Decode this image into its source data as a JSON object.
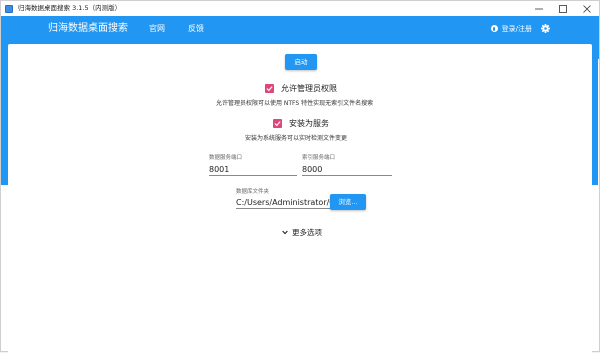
{
  "window": {
    "title": "归海数据桌面搜索 3.1.5（内测版）"
  },
  "header": {
    "brand": "归海数据桌面搜索",
    "nav": [
      {
        "label": "官网"
      },
      {
        "label": "反馈"
      }
    ],
    "login_label": "登录/注册"
  },
  "main": {
    "start_label": "启动",
    "admin_option": {
      "label": "允许管理员权限",
      "checked": true,
      "hint": "允许管理员权限可以使用 NTFS 特性实现无索引文件名搜索"
    },
    "service_option": {
      "label": "安装为服务",
      "checked": true,
      "hint": "安装为系统服务可以实时检测文件变更"
    },
    "data_port": {
      "label": "数据服务端口",
      "value": "8001"
    },
    "index_port": {
      "label": "索引服务端口",
      "value": "8000"
    },
    "db_folder": {
      "label": "数据库文件夹",
      "value": "C:/Users/Administrator/C"
    },
    "browse_label": "浏览...",
    "more_label": "更多选项"
  },
  "colors": {
    "primary": "#2196f3",
    "checkbox": "#e0457b"
  }
}
